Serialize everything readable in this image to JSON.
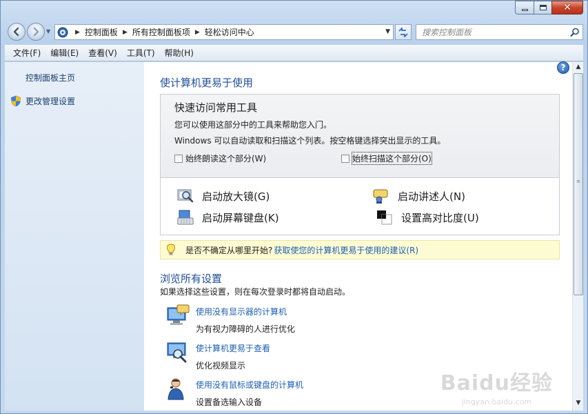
{
  "window": {
    "controls": {
      "minimize": "minimize-icon",
      "maximize": "maximize-icon",
      "close": "close-icon"
    }
  },
  "nav": {
    "breadcrumbs": [
      "控制面板",
      "所有控制面板项",
      "轻松访问中心"
    ],
    "search_placeholder": "搜索控制面板"
  },
  "menu": [
    "文件(F)",
    "编辑(E)",
    "查看(V)",
    "工具(T)",
    "帮助(H)"
  ],
  "sidebar": {
    "home_link": "控制面板主页",
    "admin_link": "更改管理设置"
  },
  "main": {
    "title": "使计算机更易于使用",
    "quick": {
      "title": "快速访问常用工具",
      "line1": "您可以使用这部分中的工具来帮助您入门。",
      "line2": "Windows 可以自动读取和扫描这个列表。按空格键选择突出显示的工具。",
      "check_read": "始终朗读这个部分(W)",
      "check_scan": "始终扫描这个部分(O)",
      "check_read_checked": false,
      "check_scan_checked": false
    },
    "tools": {
      "magnifier": "启动放大镜(G)",
      "narrator": "启动讲述人(N)",
      "keyboard": "启动屏幕键盘(K)",
      "contrast": "设置高对比度(U)"
    },
    "tip": {
      "prefix": "是否不确定从哪里开始?",
      "link": "获取使您的计算机更易于使用的建议(R)"
    },
    "browse": {
      "title": "浏览所有设置",
      "desc": "如果选择这些设置，则在每次登录时都将自动启动。",
      "items": [
        {
          "link": "使用没有显示器的计算机",
          "desc": "为有视力障碍的人进行优化"
        },
        {
          "link": "使计算机更易于查看",
          "desc": "优化视频显示"
        },
        {
          "link": "使用没有鼠标或键盘的计算机",
          "desc": "设置备选输入设备"
        }
      ]
    }
  },
  "watermark": {
    "main": "Baidu经验",
    "sub": "jingyan.baidu.com"
  },
  "colors": {
    "link": "#1e5fb5",
    "heading": "#1e4e9a",
    "tip_bg": "#fdfbd2"
  }
}
